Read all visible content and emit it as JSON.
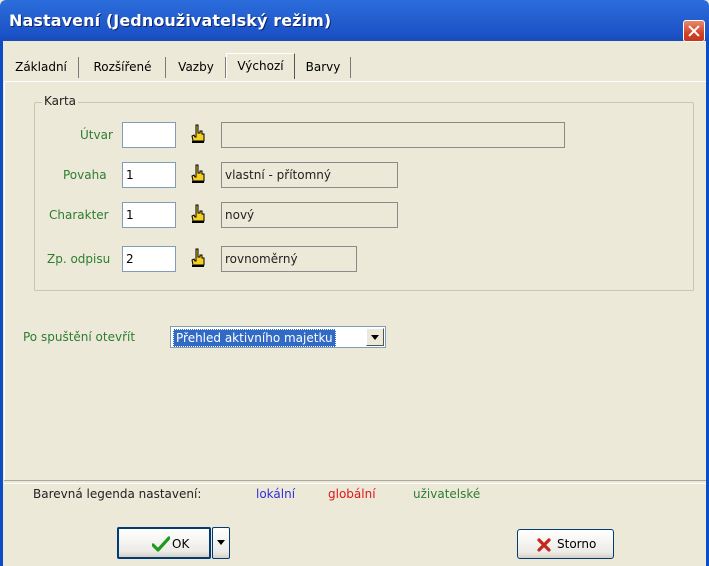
{
  "window": {
    "title": "Nastavení (Jednouživatelský režim)"
  },
  "tabs": [
    {
      "label": "Základní",
      "active": false
    },
    {
      "label": "Rozšířené",
      "active": false
    },
    {
      "label": "Vazby",
      "active": false
    },
    {
      "label": "Výchozí",
      "active": true
    },
    {
      "label": "Barvy",
      "active": false
    }
  ],
  "karta": {
    "legend": "Karta",
    "rows": [
      {
        "label": "Útvar",
        "value": "",
        "description": ""
      },
      {
        "label": "Povaha",
        "value": "1",
        "description": "vlastní - přítomný"
      },
      {
        "label": "Charakter",
        "value": "1",
        "description": "nový"
      },
      {
        "label": "Zp. odpisu",
        "value": "2",
        "description": "rovnoměrný"
      }
    ]
  },
  "startup": {
    "label": "Po spuštění otevřít",
    "selected": "Přehled aktivního majetku"
  },
  "legend": {
    "label": "Barevná legenda nastavení:",
    "items": [
      {
        "label": "lokální",
        "color": "#2F2FD8"
      },
      {
        "label": "globální",
        "color": "#E01515"
      },
      {
        "label": "uživatelské",
        "color": "#2E7D32"
      }
    ]
  },
  "buttons": {
    "ok": "OK",
    "storno": "Storno"
  },
  "colors": {
    "accent": "#2560D0",
    "field_label": "#2E7D32"
  }
}
